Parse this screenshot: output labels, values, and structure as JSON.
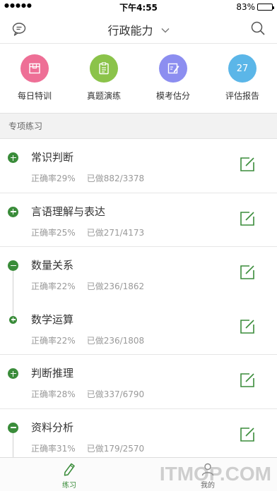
{
  "status_bar": {
    "signal": "●●●●●",
    "time": "下午4:55",
    "battery": "83%"
  },
  "nav": {
    "title": "行政能力",
    "title_icon": "chevron-down-icon",
    "left_icon": "message-icon",
    "right_icon": "search-icon"
  },
  "quick_actions": [
    {
      "label": "每日特训",
      "icon": "calendar-icon",
      "color": "#ee6f96"
    },
    {
      "label": "真题演练",
      "icon": "clipboard-icon",
      "color": "#8bc34a"
    },
    {
      "label": "模考估分",
      "icon": "exam-edit-icon",
      "color": "#8c8ef0"
    },
    {
      "label": "评估报告",
      "icon_text": "27",
      "color": "#5bb6e8"
    }
  ],
  "section": {
    "title": "专项练习"
  },
  "practice_rows": [
    {
      "name": "常识判断",
      "accuracy": "正确率29%",
      "done": "已做882/3378",
      "mark": "plus"
    },
    {
      "name": "言语理解与表达",
      "accuracy": "正确率25%",
      "done": "已做271/4173",
      "mark": "plus"
    },
    {
      "name": "数量关系",
      "accuracy": "正确率22%",
      "done": "已做236/1862",
      "mark": "minus"
    },
    {
      "name": "数学运算",
      "accuracy": "正确率22%",
      "done": "已做236/1808",
      "mark": "plus-small"
    },
    {
      "name": "判断推理",
      "accuracy": "正确率28%",
      "done": "已做337/6790",
      "mark": "plus"
    },
    {
      "name": "资料分析",
      "accuracy": "正确率31%",
      "done": "已做179/2570",
      "mark": "minus"
    }
  ],
  "tabs": [
    {
      "label": "练习",
      "icon": "pencil-icon",
      "active": true
    },
    {
      "label": "我的",
      "icon": "user-icon",
      "active": false
    }
  ],
  "watermark": "ITMOP.COM",
  "colors": {
    "accent": "#3a8c3a"
  }
}
